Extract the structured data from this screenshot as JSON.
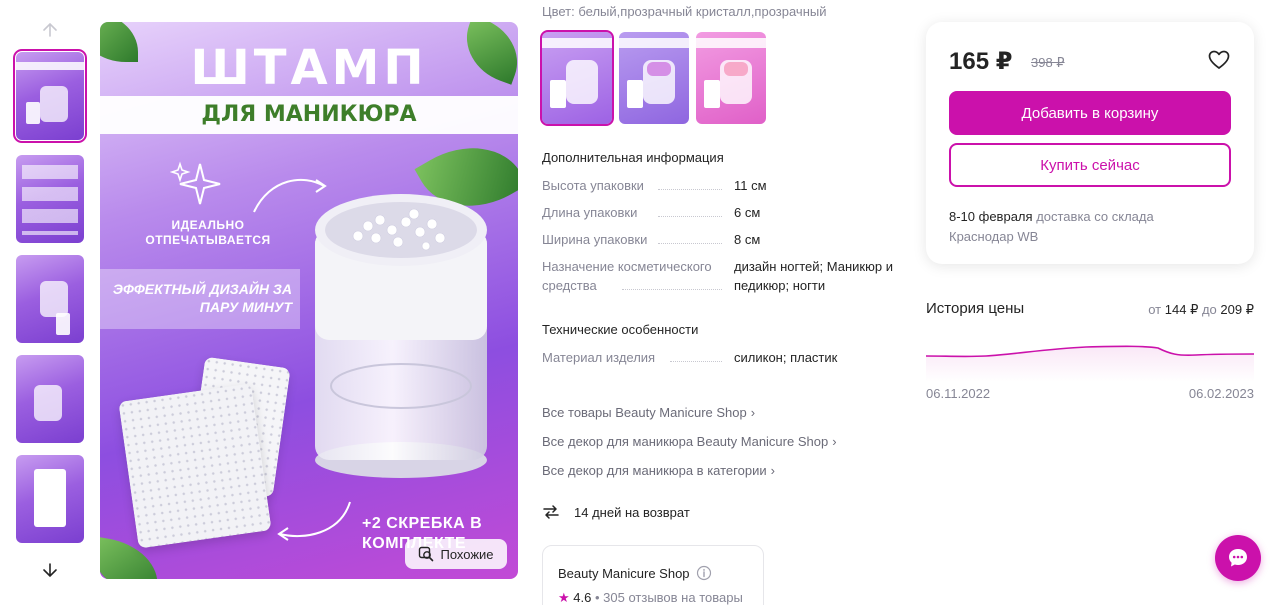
{
  "gallery": {
    "main_title": "ШТАМП",
    "main_subtitle": "ДЛЯ МАНИКЮРА",
    "feature_1": "ИДЕАЛЬНО ОТПЕЧАТЫВАЕТСЯ",
    "feature_2": "ЭФФЕКТНЫЙ ДИЗАЙН ЗА ПАРУ МИНУТ",
    "feature_3": "+2 СКРЕБКА В КОМПЛЕКТЕ",
    "similar_label": "Похожие",
    "thumbnails": [
      "thumb-1",
      "thumb-2",
      "thumb-3",
      "thumb-4",
      "thumb-5"
    ],
    "active_thumbnail": 0
  },
  "product": {
    "color_label": "Цвет:",
    "color_value": "белый,прозрачный кристалл,прозрачный",
    "swatch_colors": [
      "#a66be8",
      "#9b6ee6",
      "#e47ad6"
    ]
  },
  "specs": {
    "additional_title": "Дополнительная информация",
    "additional": [
      {
        "label": "Высота упаковки",
        "value": "11 см"
      },
      {
        "label": "Длина упаковки",
        "value": "6 см"
      },
      {
        "label": "Ширина упаковки",
        "value": "8 см"
      },
      {
        "label": "Назначение косметического средства",
        "value": "дизайн ногтей; Маникюр и педикюр; ногти"
      }
    ],
    "technical_title": "Технические особенности",
    "technical": [
      {
        "label": "Материал изделия",
        "value": "силикон; пластик"
      }
    ]
  },
  "links": [
    "Все товары Beauty Manicure Shop",
    "Все декор для маникюра Beauty Manicure Shop",
    "Все декор для маникюра в категории"
  ],
  "return_policy": "14 дней на возврат",
  "seller": {
    "name": "Beauty Manicure Shop",
    "rating": "4.6",
    "reviews": "305 отзывов на товары"
  },
  "buy": {
    "price": "165 ₽",
    "old_price": "398 ₽",
    "add_to_cart": "Добавить в корзину",
    "buy_now": "Купить сейчас",
    "delivery_date": "8-10 февраля",
    "delivery_text": "доставка со склада Краснодар WB"
  },
  "price_history": {
    "title": "История цены",
    "from_label": "от",
    "from_value": "144 ₽",
    "to_label": "до",
    "to_value": "209 ₽",
    "start_date": "06.11.2022",
    "end_date": "06.02.2023",
    "line_color": "#cb11ab"
  },
  "colors": {
    "accent": "#cb11ab",
    "muted_text": "#868695",
    "text": "#242424"
  },
  "icons": {
    "up": "arrow-up-icon",
    "down": "arrow-down-icon",
    "favorite": "heart-icon",
    "return": "return-arrows-icon",
    "info": "info-icon",
    "chat": "chat-icon",
    "similar": "search-similar-icon"
  }
}
